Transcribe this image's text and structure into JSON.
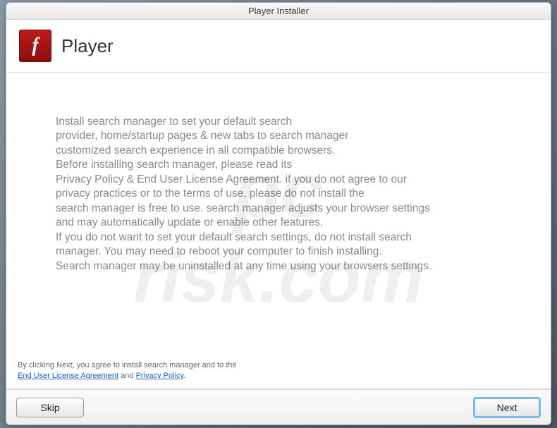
{
  "window": {
    "title": "Player Installer"
  },
  "header": {
    "title": "Player",
    "icon_glyph": "f"
  },
  "body": {
    "lines": [
      "Install search manager to set your default search",
      "provider, home/startup pages & new tabs to search manager",
      "customized search experience in all compatible browsers.",
      "Before installing search manager, please read its",
      "Privacy Policy & End User License Agreement. if you do not agree to our",
      "privacy practices or to the terms of use, please do not install the",
      "search manager is free to use. search manager adjusts your browser settings",
      "and may automatically update or enable other features.",
      "If you do not want to set your default search settings, do not install search",
      "manager. You may need to reboot your computer to finish installing.",
      "Search manager may be uninstalled at any time using your browsers settings."
    ]
  },
  "legal": {
    "line1": "By clicking Next, you agree to install search manager and to the",
    "eula": "End User License Agreement",
    "and": " and ",
    "privacy": "Privacy Policy",
    "suffix": "."
  },
  "footer": {
    "skip_label": "Skip",
    "next_label": "Next"
  },
  "watermark": {
    "top": "pc",
    "bottom": "risk.com"
  }
}
